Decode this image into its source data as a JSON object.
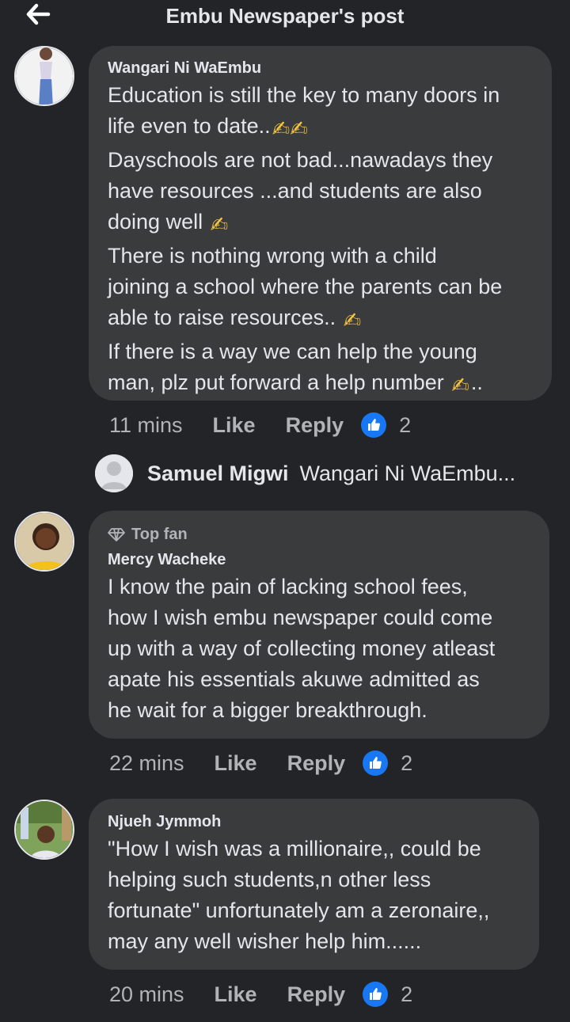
{
  "header": {
    "title": "Embu Newspaper's post",
    "back_icon": "back-arrow-icon"
  },
  "comments": [
    {
      "author": "Wangari Ni WaEmbu",
      "lines": [
        {
          "text": "Education is still the key to many doors in",
          "emoji": ""
        },
        {
          "text": "life even to date..",
          "emoji": "✍✍"
        },
        {
          "text": "Dayschools are not bad...nawadays they",
          "emoji": ""
        },
        {
          "text": "have resources ...and students are also",
          "emoji": ""
        },
        {
          "text": "doing well",
          "emoji": "✍"
        },
        {
          "text": "There is nothing wrong with a child",
          "emoji": ""
        },
        {
          "text": "joining a school where the parents can be",
          "emoji": ""
        },
        {
          "text": "able to raise resources..",
          "emoji": "✍"
        },
        {
          "text": "If there is a way we can help the young",
          "emoji": ""
        },
        {
          "text": "man, plz put forward a help number",
          "emoji": "✍",
          "after": ".."
        }
      ],
      "time": "11 mins",
      "like": "Like",
      "reply": "Reply",
      "reactions": "2"
    },
    {
      "badge": "Top fan",
      "author": "Mercy Wacheke",
      "lines": [
        {
          "text": "I know the pain of lacking school fees,",
          "emoji": ""
        },
        {
          "text": "how I wish embu newspaper could come",
          "emoji": ""
        },
        {
          "text": "up with a way of collecting money atleast",
          "emoji": ""
        },
        {
          "text": "apate his essentials akuwe admitted as",
          "emoji": ""
        },
        {
          "text": "he wait for a bigger breakthrough.",
          "emoji": ""
        }
      ],
      "time": "22 mins",
      "like": "Like",
      "reply": "Reply",
      "reactions": "2"
    },
    {
      "author": "Njueh Jymmoh",
      "lines": [
        {
          "text": "\"How I wish was a millionaire,, could be",
          "emoji": ""
        },
        {
          "text": "helping such students,n other less",
          "emoji": ""
        },
        {
          "text": "fortunate\" unfortunately am a zeronaire,,",
          "emoji": ""
        },
        {
          "text": "may any well wisher help him......",
          "emoji": ""
        }
      ],
      "time": "20 mins",
      "like": "Like",
      "reply": "Reply",
      "reactions": "2"
    }
  ],
  "reply_preview": {
    "author": "Samuel Migwi",
    "text": "Wangari Ni WaEmbu..."
  },
  "colors": {
    "background": "#232427",
    "bubble": "#3a3b3c",
    "text": "#e4e6eb",
    "muted": "#b0b3b8",
    "like_blue": "#1877f2"
  }
}
